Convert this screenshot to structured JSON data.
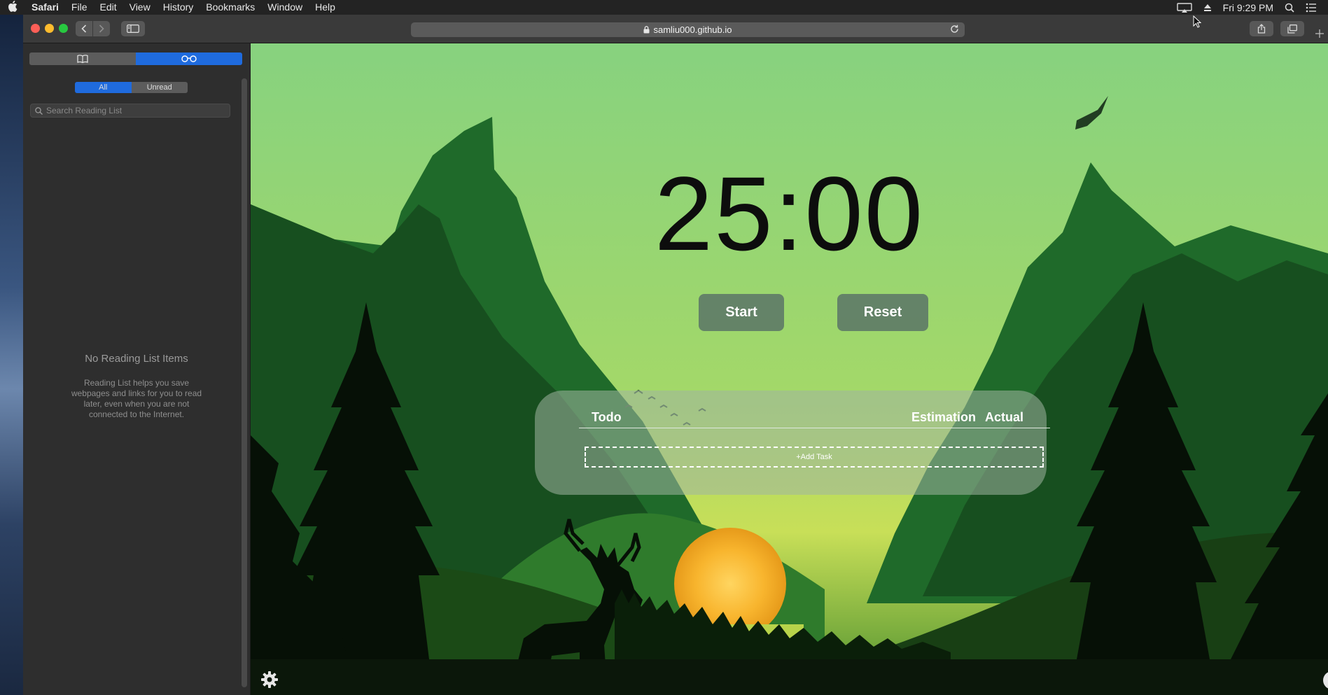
{
  "menubar": {
    "app": "Safari",
    "items": [
      "File",
      "Edit",
      "View",
      "History",
      "Bookmarks",
      "Window",
      "Help"
    ],
    "clock": "Fri 9:29 PM",
    "icons": [
      "apple-icon",
      "airplay-icon",
      "eject-icon",
      "spotlight-icon",
      "control-center-icon"
    ]
  },
  "browser": {
    "url": "samliu000.github.io",
    "icons": [
      "back-icon",
      "forward-icon",
      "sidebar-icon",
      "lock-icon",
      "reload-icon",
      "share-icon",
      "tabs-icon",
      "new-tab-icon"
    ]
  },
  "sidebar": {
    "filter_all": "All",
    "filter_unread": "Unread",
    "search_placeholder": "Search Reading List",
    "empty_title": "No Reading List Items",
    "empty_desc": "Reading List helps you save webpages and links for you to read later, even when you are not connected to the Internet."
  },
  "app": {
    "timer": "25:00",
    "start_label": "Start",
    "reset_label": "Reset",
    "todo_header": "Todo",
    "estimation_header": "Estimation",
    "actual_header": "Actual",
    "add_task_label": "+Add Task",
    "help_label": "?"
  },
  "colors": {
    "accent": "#1f6bde",
    "sky_top": "#8ad37f",
    "sky_bottom": "#c8df58",
    "sun": "#f8b52e"
  }
}
